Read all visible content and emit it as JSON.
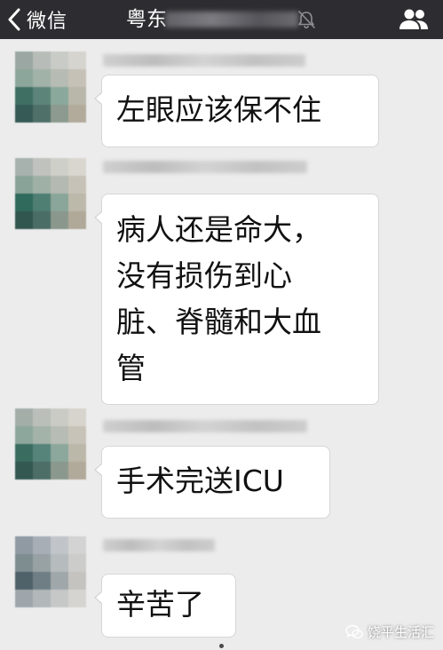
{
  "navbar": {
    "back_label": "微信",
    "title": "粤东"
  },
  "messages": [
    {
      "text": "左眼应该保不住"
    },
    {
      "text": "病人还是命大，\n没有损伤到心\n脏、脊髓和大血\n管"
    },
    {
      "text": "手术完送ICU"
    },
    {
      "text": "辛苦了"
    }
  ],
  "watermark": {
    "text": "饶平生活汇"
  },
  "colors": {
    "navbar_bg": "#2d2d31",
    "chat_bg": "#ececec",
    "bubble_bg": "#ffffff"
  }
}
